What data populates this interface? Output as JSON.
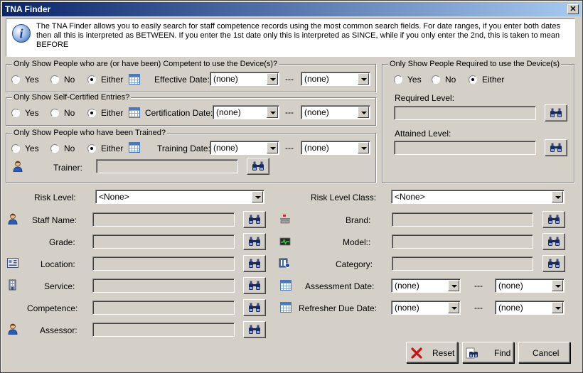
{
  "window": {
    "title": "TNA Finder",
    "close_glyph": "✕"
  },
  "info": {
    "icon": "info-icon",
    "text": "The TNA Finder allows you to easily search for staff competence records using the most common search fields. For date ranges, if you enter both dates then all this is interpreted as BETWEEN. If you enter the 1st date only this is interpreted as SINCE, while if you only enter the 2nd, this is taken to mean BEFORE"
  },
  "radio_labels": {
    "yes": "Yes",
    "no": "No",
    "either": "Either"
  },
  "date_sep": "---",
  "competent_group": {
    "legend": "Only Show People who are (or have been) Competent to use the Device(s)?",
    "selected": "either",
    "date_label": "Effective Date:",
    "from": "(none)",
    "to": "(none)"
  },
  "self_cert_group": {
    "legend": "Only Show Self-Certified Entries?",
    "selected": "either",
    "date_label": "Certification Date:",
    "from": "(none)",
    "to": "(none)"
  },
  "trained_group": {
    "legend": "Only Show People who have been Trained?",
    "selected": "either",
    "date_label": "Training Date:",
    "from": "(none)",
    "to": "(none)",
    "trainer_label": "Trainer:",
    "trainer_value": ""
  },
  "required_group": {
    "legend": "Only Show People Required to use the Device(s)",
    "selected": "either",
    "required_label": "Required Level:",
    "required_value": "",
    "attained_label": "Attained Level:",
    "attained_value": ""
  },
  "left_fields": {
    "risk_level_label": "Risk Level:",
    "risk_level_value": "<None>",
    "staff_name_label": "Staff Name:",
    "staff_name_value": "",
    "grade_label": "Grade:",
    "grade_value": "",
    "location_label": "Location:",
    "location_value": "",
    "service_label": "Service:",
    "service_value": "",
    "competence_label": "Competence:",
    "competence_value": "",
    "assessor_label": "Assessor:",
    "assessor_value": ""
  },
  "right_fields": {
    "risk_class_label": "Risk Level Class:",
    "risk_class_value": "<None>",
    "brand_label": "Brand:",
    "brand_value": "",
    "model_label": "Model::",
    "model_value": "",
    "category_label": "Category:",
    "category_value": "",
    "assessment_date_label": "Assessment  Date:",
    "assessment_from": "(none)",
    "assessment_to": "(none)",
    "refresher_label": "Refresher Due Date:",
    "refresher_from": "(none)",
    "refresher_to": "(none)"
  },
  "buttons": {
    "reset": "Reset",
    "find": "Find",
    "cancel": "Cancel"
  },
  "colors": {
    "titlebar": "#0a246a",
    "face": "#d4d0c8",
    "reset_icon": "#d01010"
  }
}
